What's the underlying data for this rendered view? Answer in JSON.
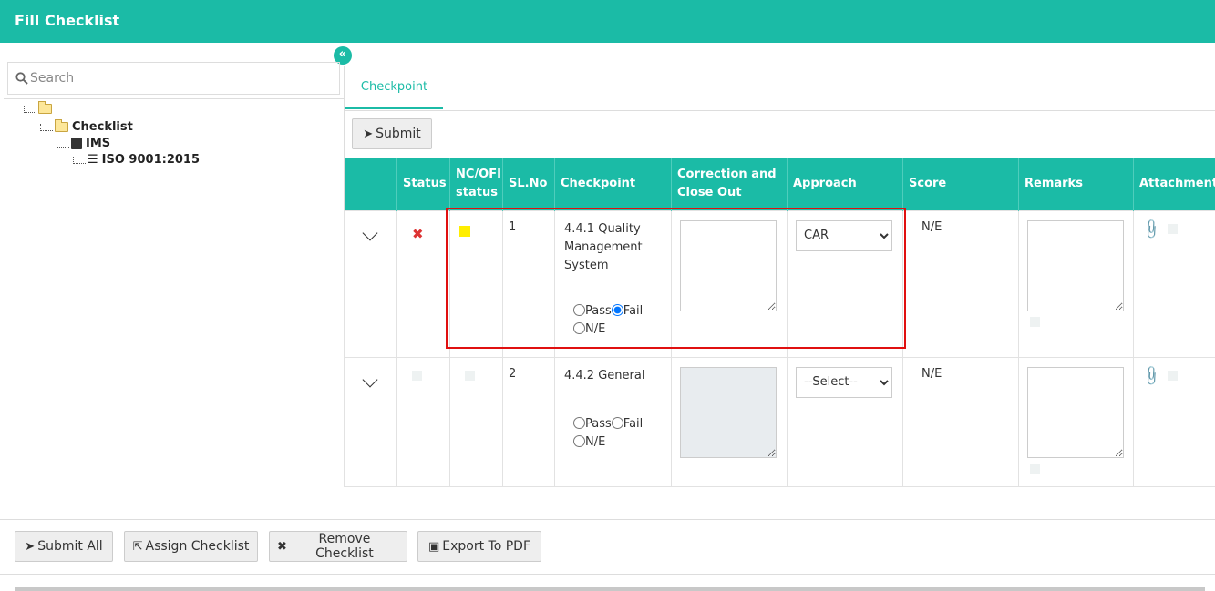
{
  "header": {
    "title": "Fill Checklist"
  },
  "sidebar": {
    "collapse_label": "«",
    "search_placeholder": "Search",
    "tree": [
      {
        "label": ""
      },
      {
        "label": "Checklist"
      },
      {
        "label": "IMS"
      },
      {
        "label": "ISO 9001:2015"
      }
    ]
  },
  "tabs": [
    {
      "label": "Checkpoint",
      "active": true
    }
  ],
  "toolbar": {
    "submit_label": "Submit"
  },
  "table": {
    "headers": {
      "status": "Status",
      "ncofi": "NC/OFI status",
      "slno": "SL.No",
      "checkpoint": "Checkpoint",
      "correction": "Correction and Close Out",
      "approach": "Approach",
      "score": "Score",
      "remarks": "Remarks",
      "attachments": "Attachments"
    },
    "rows": [
      {
        "slno": "1",
        "checkpoint": "4.4.1 Quality Management System",
        "options": {
          "pass": "Pass",
          "fail": "Fail",
          "ne": "N/E"
        },
        "selected": "Fail",
        "approach": "CAR",
        "score": "N/E",
        "status_icon": "fail-x-icon",
        "ncofi_color": "#ffee00"
      },
      {
        "slno": "2",
        "checkpoint": "4.4.2 General",
        "options": {
          "pass": "Pass",
          "fail": "Fail",
          "ne": "N/E"
        },
        "selected": "",
        "approach": "--Select--",
        "score": "N/E"
      }
    ]
  },
  "footer": {
    "submit_all": "Submit All",
    "assign_checklist": "Assign Checklist",
    "remove_checklist": "Remove Checklist",
    "export_pdf": "Export To PDF"
  },
  "colors": {
    "accent": "#1bbba6",
    "highlight": "#e01010"
  }
}
